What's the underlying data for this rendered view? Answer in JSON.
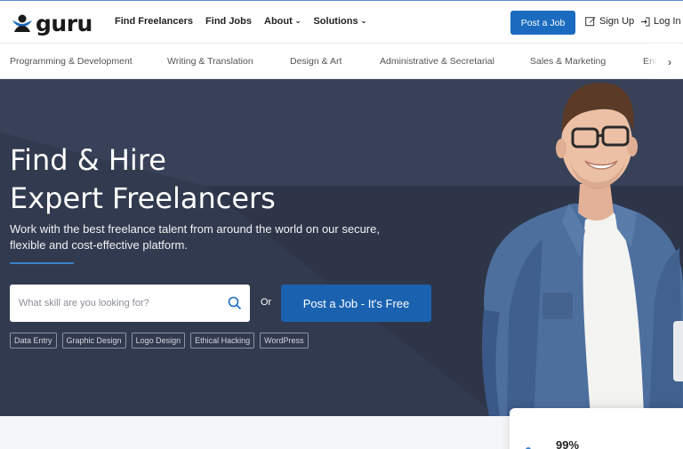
{
  "header": {
    "logo_text": "guru",
    "nav": [
      {
        "label": "Find Freelancers",
        "dropdown": false
      },
      {
        "label": "Find Jobs",
        "dropdown": false
      },
      {
        "label": "About",
        "dropdown": true
      },
      {
        "label": "Solutions",
        "dropdown": true
      }
    ],
    "post_job_label": "Post a Job",
    "signup_label": "Sign Up",
    "login_label": "Log In"
  },
  "categories": [
    "Programming & Development",
    "Writing & Translation",
    "Design & Art",
    "Administrative & Secretarial",
    "Sales & Marketing",
    "Eng"
  ],
  "hero": {
    "title_line1": "Find & Hire",
    "title_line2": "Expert Freelancers",
    "subtitle": "Work with the best freelance talent from around the world on our secure, flexible and cost-effective platform.",
    "search_placeholder": "What skill are you looking for?",
    "or_label": "Or",
    "cta_label": "Post a Job - It's Free",
    "tags": [
      "Data Entry",
      "Graphic Design",
      "Logo Design",
      "Ethical Hacking",
      "WordPress"
    ]
  },
  "stats": {
    "card_percent": "99%"
  },
  "colors": {
    "brand_blue": "#1a6bbf",
    "hero_bg": "#323a4f",
    "accent_line": "#3b82c9"
  }
}
